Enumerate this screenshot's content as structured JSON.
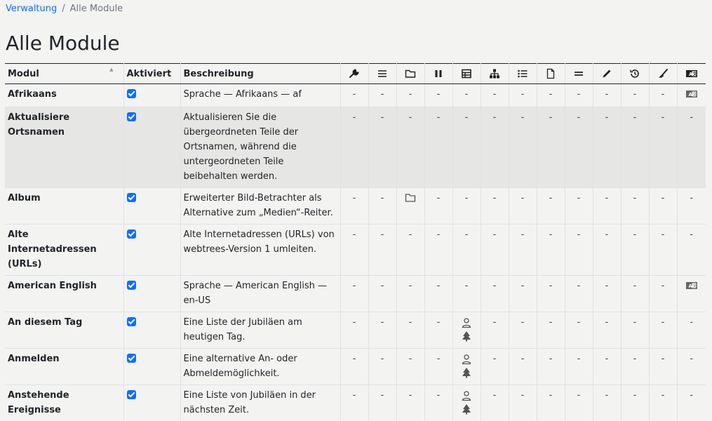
{
  "breadcrumb": {
    "parent": "Verwaltung",
    "separator": "/",
    "current": "Alle Module"
  },
  "page_title": "Alle Module",
  "columns": {
    "modul": "Modul",
    "sort_indicator": "▲",
    "aktiviert": "Aktiviert",
    "beschreibung": "Beschreibung",
    "icon_columns": [
      "wrench-icon",
      "menu-icon",
      "folder-icon",
      "pause-icon",
      "table-icon",
      "tree-chart-icon",
      "list-icon",
      "document-icon",
      "equals-icon",
      "pencil-icon",
      "history-icon",
      "brush-icon",
      "language-icon"
    ]
  },
  "dash": "-",
  "rows": [
    {
      "name": "Afrikaans",
      "description": "Sprache — Afrikaans — af",
      "enabled": true
    },
    {
      "name": "Aktualisiere Ortsnamen",
      "description": "Aktualisieren Sie die übergeordneten Teile der Ortsnamen, während die untergeordneten Teile beibehalten werden.",
      "enabled": true
    },
    {
      "name": "Album",
      "description": "Erweiterter Bild-Betrachter als Alternative zum „Medien“-Reiter.",
      "enabled": true
    },
    {
      "name": "Alte Internetadressen (URLs)",
      "description": "Alte Internetadressen (URLs) von webtrees-Version 1 umleiten.",
      "enabled": true
    },
    {
      "name": "American English",
      "description": "Sprache — American English — en-US",
      "enabled": true
    },
    {
      "name": "An diesem Tag",
      "description": "Eine Liste der Jubiläen am heutigen Tag.",
      "enabled": true
    },
    {
      "name": "Anmelden",
      "description": "Eine alternative An- oder Abmeldemöglichkeit.",
      "enabled": true
    },
    {
      "name": "Anstehende Ereignisse",
      "description": "Eine Liste von Jubiläen in der nächsten Zeit.",
      "enabled": true
    }
  ]
}
